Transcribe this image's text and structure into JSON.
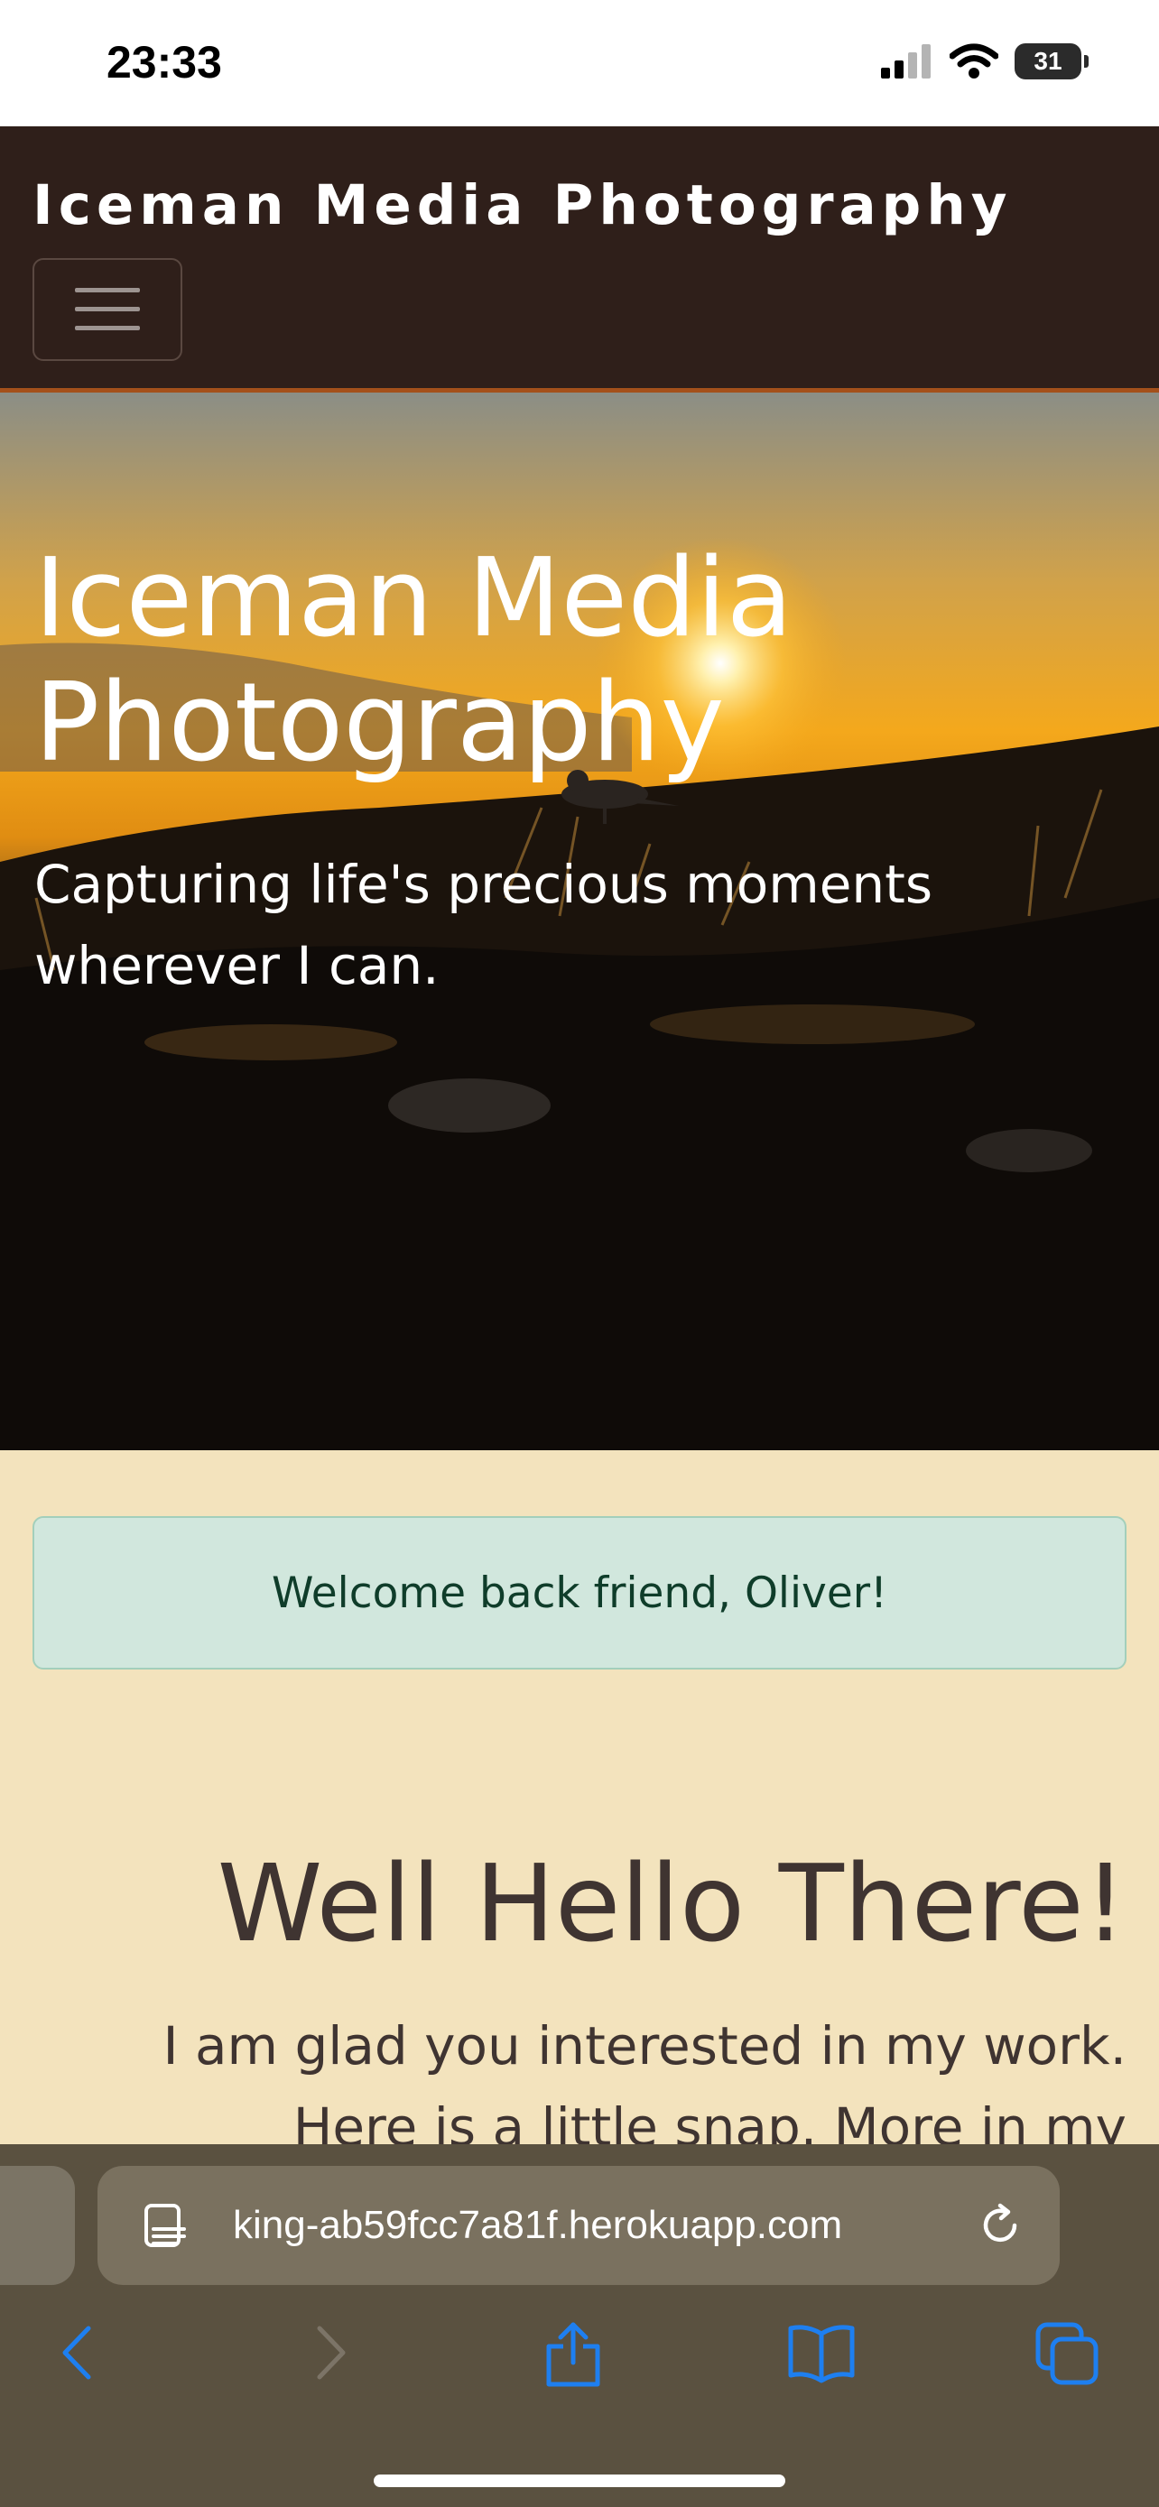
{
  "status_bar": {
    "time": "23:33",
    "battery": "31"
  },
  "navbar": {
    "brand": "Iceman Media Photography",
    "toggler_icon": "hamburger-icon"
  },
  "hero": {
    "title": "Iceman Media Photography",
    "subtitle": "Capturing life's precious moments wherever I can."
  },
  "alert": {
    "message": "Welcome back friend, Oliver!"
  },
  "welcome": {
    "title": "Well Hello There!",
    "text": "I am glad you interested in my work. Here is a little snap. More in my"
  },
  "safari": {
    "url": "king-ab59fcc7a81f.herokuapp.com",
    "icons": [
      "reader-icon",
      "reload-icon",
      "back-icon",
      "forward-icon",
      "share-icon",
      "bookmarks-icon",
      "tabs-icon"
    ]
  },
  "colors": {
    "navbar_bg": "#2f1f1a",
    "navbar_border": "#a4501b",
    "page_bg": "#f3e3bd",
    "alert_bg": "#d1e7dd",
    "heading_text": "#3f3431",
    "safari_accent": "#1e7ff0"
  }
}
